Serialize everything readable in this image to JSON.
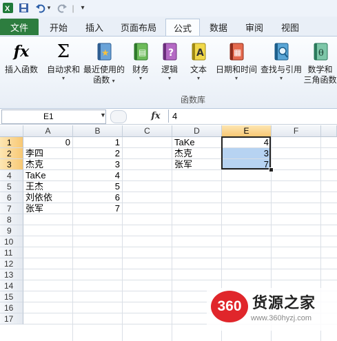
{
  "qat": {
    "separator": "|",
    "undo_caret": "▾",
    "customize": "▾"
  },
  "tabs": {
    "file": "文件",
    "items": [
      "开始",
      "插入",
      "页面布局",
      "公式",
      "数据",
      "审阅",
      "视图"
    ],
    "active": "公式"
  },
  "ribbon": {
    "buttons": [
      {
        "label": "插入函数",
        "label2": "",
        "icon": "fx-icon",
        "glyph": "fx",
        "caret": false
      },
      {
        "label": "自动求和",
        "label2": "",
        "icon": "sigma-icon",
        "glyph": "Σ",
        "caret": true
      },
      {
        "label": "最近使用的",
        "label2": "函数",
        "icon": "recent-book-icon",
        "glyph": "★",
        "caret": true
      },
      {
        "label": "财务",
        "label2": "",
        "icon": "finance-book-icon",
        "glyph": "▤",
        "caret": true
      },
      {
        "label": "逻辑",
        "label2": "",
        "icon": "logic-book-icon",
        "glyph": "?",
        "caret": true
      },
      {
        "label": "文本",
        "label2": "",
        "icon": "text-book-icon",
        "glyph": "A",
        "caret": true
      },
      {
        "label": "日期和时间",
        "label2": "",
        "icon": "datetime-book-icon",
        "glyph": "▦",
        "caret": true
      },
      {
        "label": "查找与引用",
        "label2": "",
        "icon": "lookup-book-icon",
        "glyph": "⌕",
        "caret": true
      },
      {
        "label": "数学和",
        "label2": "三角函数",
        "icon": "math-book-icon",
        "glyph": "θ",
        "caret": false
      }
    ],
    "group_label": "函数库"
  },
  "formula_bar": {
    "name_box": "E1",
    "fx": "fx",
    "value": "4"
  },
  "columns": [
    "A",
    "B",
    "C",
    "D",
    "E",
    "F"
  ],
  "rows": [
    "1",
    "2",
    "3",
    "4",
    "5",
    "6",
    "7",
    "8",
    "9",
    "10",
    "11",
    "12",
    "13",
    "14",
    "15",
    "16",
    "17"
  ],
  "cells": {
    "A": [
      "0",
      "李四",
      "杰克",
      "TaKe",
      "王杰",
      "刘依依",
      "张军"
    ],
    "B": [
      "1",
      "2",
      "3",
      "4",
      "5",
      "6",
      "7"
    ],
    "D": [
      "TaKe",
      "杰克",
      "张军"
    ],
    "E": [
      "4",
      "3",
      "7"
    ]
  },
  "watermark": {
    "badge": "360",
    "name": "货源之家",
    "url": "www.360hyzj.com"
  },
  "colors": {
    "file_tab": "#2d7d3f",
    "selection": "#b7d3f2",
    "header_selected": "#f8c874",
    "watermark_red": "#e0262b"
  }
}
